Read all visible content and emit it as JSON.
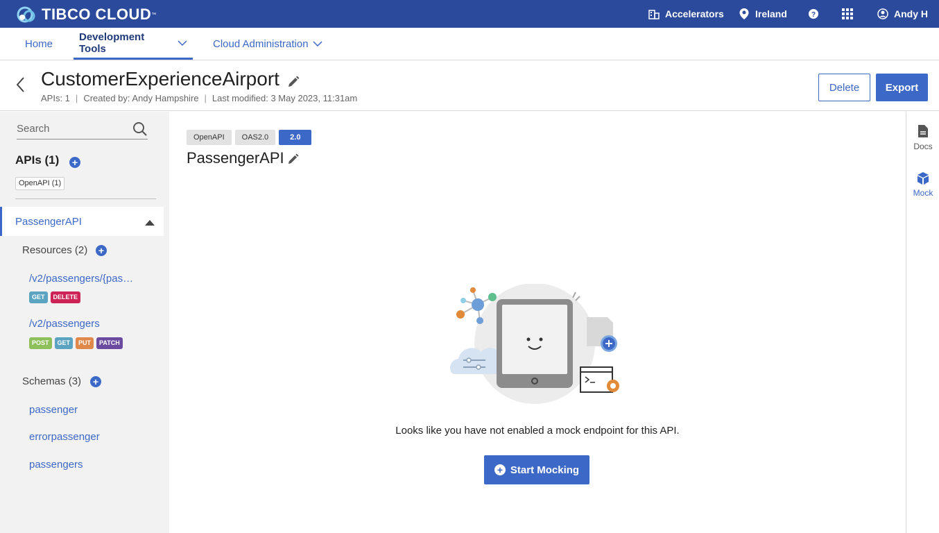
{
  "topbar": {
    "brand": "TIBCO CLOUD",
    "accelerators": "Accelerators",
    "region": "Ireland",
    "user": "Andy H"
  },
  "subnav": {
    "home": "Home",
    "dev_tools": "Development Tools",
    "cloud_admin": "Cloud Administration"
  },
  "header": {
    "title": "CustomerExperienceAirport",
    "meta_apis": "APIs: 1",
    "meta_created": "Created by: Andy Hampshire",
    "meta_modified": "Last modified: 3 May 2023, 11:31am",
    "delete_label": "Delete",
    "export_label": "Export"
  },
  "sidebar": {
    "search_placeholder": "Search",
    "apis_title": "APIs (1)",
    "openapi_chip": "OpenAPI (1)",
    "api_name": "PassengerAPI",
    "resources_title": "Resources (2)",
    "resources": [
      {
        "path": "/v2/passengers/{pas…",
        "methods": [
          "GET",
          "DELETE"
        ]
      },
      {
        "path": "/v2/passengers",
        "methods": [
          "POST",
          "GET",
          "PUT",
          "PATCH"
        ]
      }
    ],
    "schemas_title": "Schemas (3)",
    "schemas": [
      "passenger",
      "errorpassenger",
      "passengers"
    ]
  },
  "main": {
    "tags": [
      "OpenAPI",
      "OAS2.0",
      "2.0"
    ],
    "api_title": "PassengerAPI",
    "empty_message": "Looks like you have not enabled a mock endpoint for this API.",
    "start_mocking": "Start Mocking"
  },
  "rightbar": {
    "docs": "Docs",
    "mock": "Mock"
  },
  "colors": {
    "brand": "#2c4a9c",
    "accent": "#3c68c7",
    "get": "#5ba4c1",
    "delete": "#cc2255",
    "post": "#8dc05a",
    "put": "#e0884a",
    "patch": "#6b4ba0"
  }
}
